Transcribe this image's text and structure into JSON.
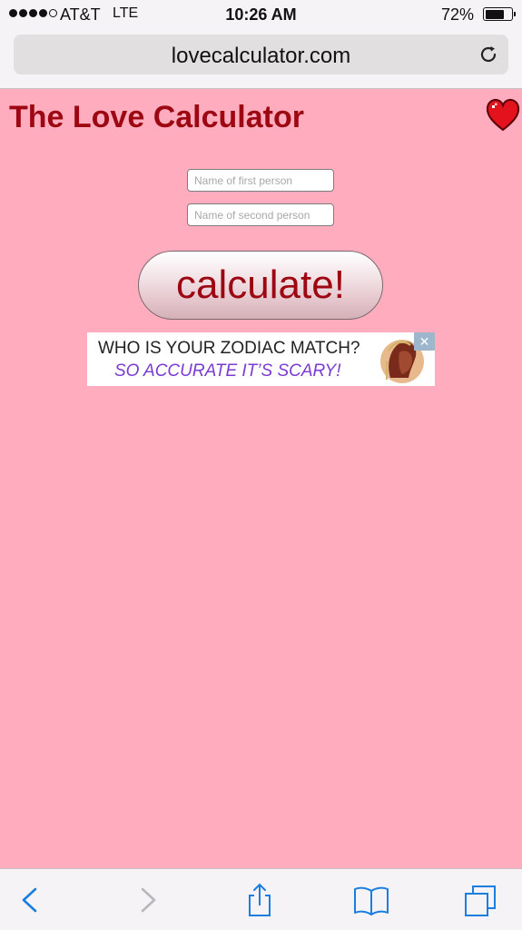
{
  "status_bar": {
    "carrier": "AT&T",
    "network": "LTE",
    "time": "10:26 AM",
    "battery_percent": "72%",
    "signal_bars": 4,
    "signal_total": 5,
    "battery_level": 0.72
  },
  "browser": {
    "url": "lovecalculator.com",
    "reload_icon": "reload-icon"
  },
  "page": {
    "title": "The Love Calculator",
    "heart_icon": "heart-icon",
    "first_name_placeholder": "Name of first person",
    "second_name_placeholder": "Name of second person",
    "calculate_label": "calculate!"
  },
  "ad": {
    "headline": "WHO IS YOUR ZODIAC MATCH?",
    "tagline": "SO ACCURATE IT’S SCARY!",
    "close_label": "✕"
  },
  "toolbar": {
    "icons": [
      "back-icon",
      "forward-icon",
      "share-icon",
      "bookmarks-icon",
      "tabs-icon"
    ]
  },
  "colors": {
    "page_background": "#ffadbe",
    "title_color": "#9d0712",
    "accent_blue": "#1a7ee0",
    "ad_tagline": "#7a3bd2"
  }
}
